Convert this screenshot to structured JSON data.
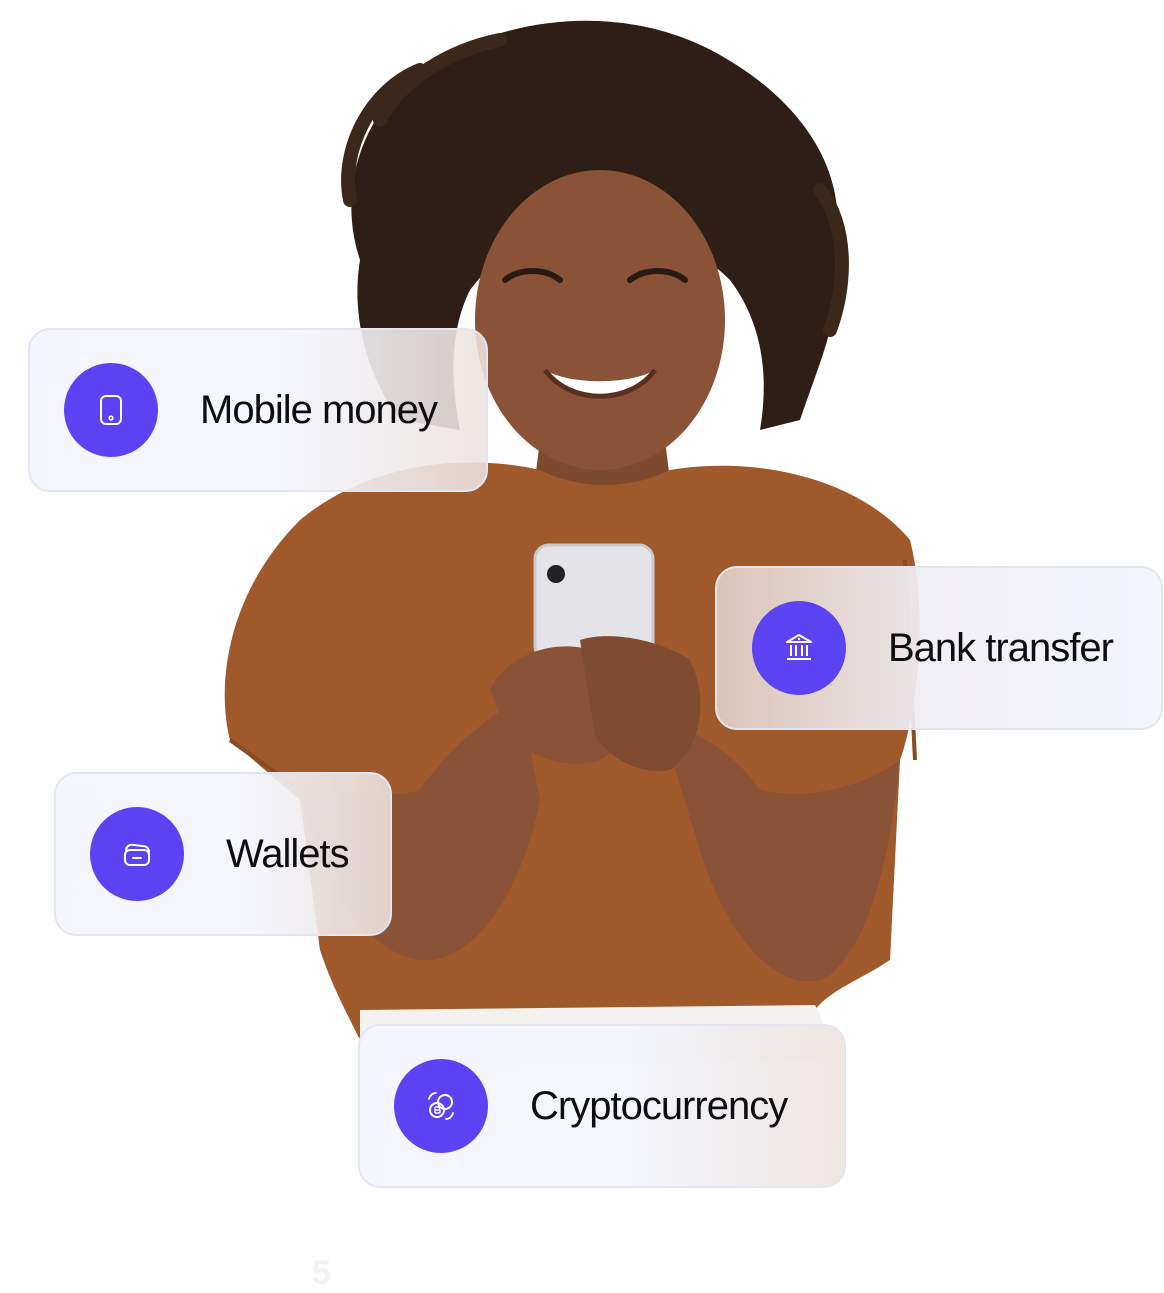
{
  "methods": [
    {
      "label": "Mobile money",
      "icon": "mobile-phone-icon"
    },
    {
      "label": "Bank transfer",
      "icon": "bank-icon"
    },
    {
      "label": "Wallets",
      "icon": "wallet-icon"
    },
    {
      "label": "Cryptocurrency",
      "icon": "crypto-exchange-icon"
    }
  ],
  "footer_number": "5",
  "colors": {
    "accent": "#5b42f3",
    "card_border": "#e3e6f0",
    "shirt": "#a0592a",
    "skin": "#8a5236",
    "hair": "#2e1e15"
  }
}
